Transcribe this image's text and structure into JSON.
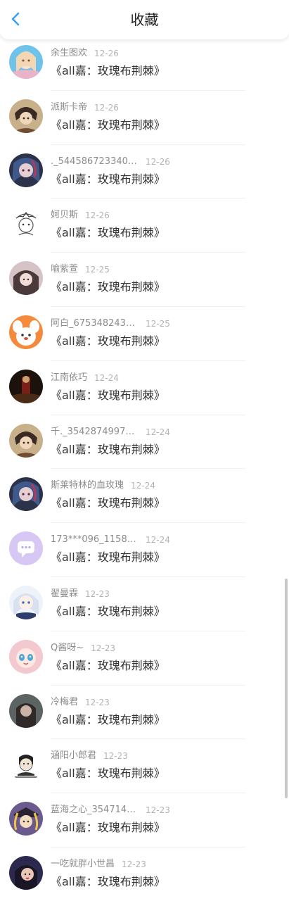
{
  "header": {
    "title": "收藏",
    "back_icon": "chevron-left-icon",
    "accent_color": "#3aa0f0"
  },
  "items": [
    {
      "username": "余生图欢",
      "date": "12-26",
      "title": "《all嘉：玫瑰布荆棘》",
      "avatar": "anime-girl-avatar"
    },
    {
      "username": "派斯卡帝",
      "date": "12-26",
      "title": "《all嘉：玫瑰布荆棘》",
      "avatar": "anime-boy-avatar"
    },
    {
      "username": "._5445867233409...",
      "date": "12-26",
      "title": "《all嘉：玫瑰布荆棘》",
      "avatar": "dark-anime-avatar"
    },
    {
      "username": "妸贝斯",
      "date": "12-26",
      "title": "《all嘉：玫瑰布荆棘》",
      "avatar": "sketch-avatar"
    },
    {
      "username": "喻紫萱",
      "date": "12-25",
      "title": "《all嘉：玫瑰布荆棘》",
      "avatar": "photo-girl-avatar"
    },
    {
      "username": "阿白_6753482432...",
      "date": "12-25",
      "title": "《all嘉：玫瑰布荆棘》",
      "avatar": "cartoon-dog-avatar"
    },
    {
      "username": "江南依巧",
      "date": "12-24",
      "title": "《all嘉：玫瑰布荆棘》",
      "avatar": "dark-scene-avatar"
    },
    {
      "username": "千._35428749977...",
      "date": "12-24",
      "title": "《all嘉：玫瑰布荆棘》",
      "avatar": "anime-boy-avatar"
    },
    {
      "username": "斯莱特林的血玫瑰",
      "date": "12-24",
      "title": "《all嘉：玫瑰布荆棘》",
      "avatar": "dark-anime-avatar"
    },
    {
      "username": "173***096_11582...",
      "date": "12-24",
      "title": "《all嘉：玫瑰布荆棘》",
      "avatar": "default-chat-avatar"
    },
    {
      "username": "翟曼霖",
      "date": "12-23",
      "title": "《all嘉：玫瑰布荆棘》",
      "avatar": "anime-white-hair-avatar"
    },
    {
      "username": "Q酱呀~",
      "date": "12-23",
      "title": "《all嘉：玫瑰布荆棘》",
      "avatar": "anime-face-avatar"
    },
    {
      "username": "冷梅君",
      "date": "12-23",
      "title": "《all嘉：玫瑰布荆棘》",
      "avatar": "photo-dark-avatar"
    },
    {
      "username": "涵阳小郎君",
      "date": "12-23",
      "title": "《all嘉：玫瑰布荆棘》",
      "avatar": "meme-avatar"
    },
    {
      "username": "蓝海之心_3547145...",
      "date": "12-23",
      "title": "《all嘉：玫瑰布荆棘》",
      "avatar": "anime-pirate-avatar"
    },
    {
      "username": "一吃就胖小世昌",
      "date": "12-23",
      "title": "《all嘉：玫瑰布荆棘》",
      "avatar": "photo-selfie-avatar"
    }
  ]
}
